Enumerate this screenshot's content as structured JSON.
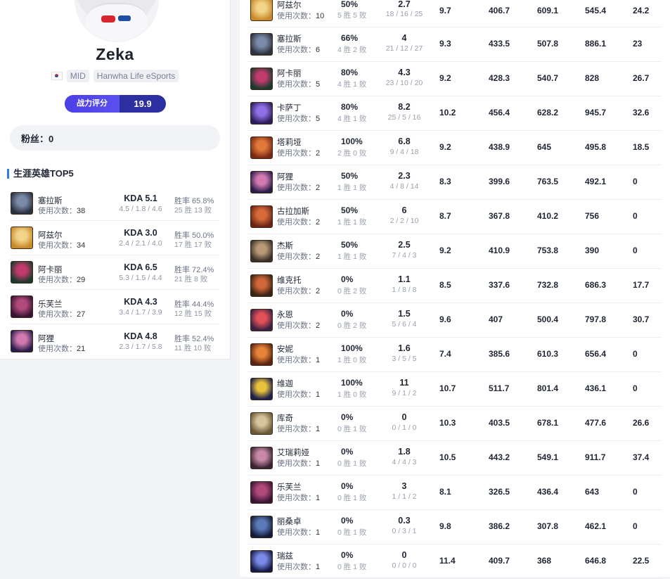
{
  "player": {
    "name": "Zeka",
    "position": "MID",
    "team": "Hanwha Life eSports",
    "rating_label": "战力评分",
    "rating_value": "19.9",
    "fans_text": "粉丝：0"
  },
  "colors": {
    "accent_blue": "#2d7be5",
    "rating_bg": "#2c2f9f",
    "rating_label_bg": "#5045ea"
  },
  "top5": {
    "title": "生涯英雄TOP5",
    "uses_label": "使用次数：",
    "items": [
      {
        "name": "塞拉斯",
        "uses": "38",
        "kda": "KDA 5.1",
        "kda_detail": "4.5 / 1.8 / 4.6",
        "winrate": "胜率 65.8%",
        "wl": "25 胜 13 败",
        "icon": "sylas-icon"
      },
      {
        "name": "阿兹尔",
        "uses": "34",
        "kda": "KDA 3.0",
        "kda_detail": "2.4 / 2.1 / 4.0",
        "winrate": "胜率 50.0%",
        "wl": "17 胜 17 败",
        "icon": "azir-icon"
      },
      {
        "name": "阿卡丽",
        "uses": "29",
        "kda": "KDA 6.5",
        "kda_detail": "5.3 / 1.5 / 4.4",
        "winrate": "胜率 72.4%",
        "wl": "21 胜 8 败",
        "icon": "akali-icon"
      },
      {
        "name": "乐芙兰",
        "uses": "27",
        "kda": "KDA 4.3",
        "kda_detail": "3.4 / 1.7 / 3.9",
        "winrate": "胜率 44.4%",
        "wl": "12 胜 15 败",
        "icon": "leblanc-icon"
      },
      {
        "name": "阿狸",
        "uses": "21",
        "kda": "KDA 4.8",
        "kda_detail": "2.3 / 1.7 / 5.8",
        "winrate": "胜率 52.4%",
        "wl": "11 胜 10 败",
        "icon": "ahri-icon"
      }
    ]
  },
  "hero_table": {
    "uses_label": "使用次数：",
    "rows": [
      {
        "name": "阿兹尔",
        "uses": "10",
        "winrate": "50%",
        "wl": "5 胜 5 败",
        "kda": "2.7",
        "kda_detail": "18 / 16 / 25",
        "c1": "9.7",
        "c2": "406.7",
        "c3": "609.1",
        "c4": "545.4",
        "c5": "24.2",
        "icon": "azir-icon"
      },
      {
        "name": "塞拉斯",
        "uses": "6",
        "winrate": "66%",
        "wl": "4 胜 2 败",
        "kda": "4",
        "kda_detail": "21 / 12 / 27",
        "c1": "9.3",
        "c2": "433.5",
        "c3": "507.8",
        "c4": "886.1",
        "c5": "23",
        "icon": "sylas-icon"
      },
      {
        "name": "阿卡丽",
        "uses": "5",
        "winrate": "80%",
        "wl": "4 胜 1 败",
        "kda": "4.3",
        "kda_detail": "23 / 10 / 20",
        "c1": "9.2",
        "c2": "428.3",
        "c3": "540.7",
        "c4": "828",
        "c5": "26.7",
        "icon": "akali-icon"
      },
      {
        "name": "卡萨丁",
        "uses": "5",
        "winrate": "80%",
        "wl": "4 胜 1 败",
        "kda": "8.2",
        "kda_detail": "25 / 5 / 16",
        "c1": "10.2",
        "c2": "456.4",
        "c3": "628.2",
        "c4": "945.7",
        "c5": "32.6",
        "icon": "kassadin-icon"
      },
      {
        "name": "塔莉垭",
        "uses": "2",
        "winrate": "100%",
        "wl": "2 胜 0 败",
        "kda": "6.8",
        "kda_detail": "9 / 4 / 18",
        "c1": "9.2",
        "c2": "438.9",
        "c3": "645",
        "c4": "495.8",
        "c5": "18.5",
        "icon": "taliyah-icon"
      },
      {
        "name": "阿狸",
        "uses": "2",
        "winrate": "50%",
        "wl": "1 胜 1 败",
        "kda": "2.3",
        "kda_detail": "4 / 8 / 14",
        "c1": "8.3",
        "c2": "399.6",
        "c3": "763.5",
        "c4": "492.1",
        "c5": "0",
        "icon": "ahri-icon"
      },
      {
        "name": "古拉加斯",
        "uses": "2",
        "winrate": "50%",
        "wl": "1 胜 1 败",
        "kda": "6",
        "kda_detail": "2 / 2 / 10",
        "c1": "8.7",
        "c2": "367.8",
        "c3": "410.2",
        "c4": "756",
        "c5": "0",
        "icon": "gragas-icon"
      },
      {
        "name": "杰斯",
        "uses": "2",
        "winrate": "50%",
        "wl": "1 胜 1 败",
        "kda": "2.5",
        "kda_detail": "7 / 4 / 3",
        "c1": "9.2",
        "c2": "410.9",
        "c3": "753.8",
        "c4": "390",
        "c5": "0",
        "icon": "jayce-icon"
      },
      {
        "name": "维克托",
        "uses": "2",
        "winrate": "0%",
        "wl": "0 胜 2 败",
        "kda": "1.1",
        "kda_detail": "1 / 8 / 8",
        "c1": "8.5",
        "c2": "337.6",
        "c3": "732.8",
        "c4": "686.3",
        "c5": "17.7",
        "icon": "viktor-icon"
      },
      {
        "name": "永恩",
        "uses": "2",
        "winrate": "0%",
        "wl": "0 胜 2 败",
        "kda": "1.5",
        "kda_detail": "5 / 6 / 4",
        "c1": "9.6",
        "c2": "407",
        "c3": "500.4",
        "c4": "797.8",
        "c5": "30.7",
        "icon": "yone-icon"
      },
      {
        "name": "安妮",
        "uses": "1",
        "winrate": "100%",
        "wl": "1 胜 0 败",
        "kda": "1.6",
        "kda_detail": "3 / 5 / 5",
        "c1": "7.4",
        "c2": "385.6",
        "c3": "610.3",
        "c4": "656.4",
        "c5": "0",
        "icon": "annie-icon"
      },
      {
        "name": "维迦",
        "uses": "1",
        "winrate": "100%",
        "wl": "1 胜 0 败",
        "kda": "11",
        "kda_detail": "9 / 1 / 2",
        "c1": "10.7",
        "c2": "511.7",
        "c3": "801.4",
        "c4": "436.1",
        "c5": "0",
        "icon": "veigar-icon"
      },
      {
        "name": "库奇",
        "uses": "1",
        "winrate": "0%",
        "wl": "0 胜 1 败",
        "kda": "0",
        "kda_detail": "0 / 1 / 0",
        "c1": "10.3",
        "c2": "403.5",
        "c3": "678.1",
        "c4": "477.6",
        "c5": "26.6",
        "icon": "corki-icon"
      },
      {
        "name": "艾瑞莉娅",
        "uses": "1",
        "winrate": "0%",
        "wl": "0 胜 1 败",
        "kda": "1.8",
        "kda_detail": "4 / 4 / 3",
        "c1": "10.5",
        "c2": "443.2",
        "c3": "549.1",
        "c4": "911.7",
        "c5": "37.4",
        "icon": "irelia-icon"
      },
      {
        "name": "乐芙兰",
        "uses": "1",
        "winrate": "0%",
        "wl": "0 胜 1 败",
        "kda": "3",
        "kda_detail": "1 / 1 / 2",
        "c1": "8.1",
        "c2": "326.5",
        "c3": "436.4",
        "c4": "643",
        "c5": "0",
        "icon": "leblanc-icon"
      },
      {
        "name": "丽桑卓",
        "uses": "1",
        "winrate": "0%",
        "wl": "0 胜 1 败",
        "kda": "0.3",
        "kda_detail": "0 / 3 / 1",
        "c1": "9.8",
        "c2": "386.2",
        "c3": "307.8",
        "c4": "462.1",
        "c5": "0",
        "icon": "lissandra-icon"
      },
      {
        "name": "瑞兹",
        "uses": "1",
        "winrate": "0%",
        "wl": "0 胜 1 败",
        "kda": "0",
        "kda_detail": "0 / 0 / 0",
        "c1": "11.4",
        "c2": "409.7",
        "c3": "368",
        "c4": "646.8",
        "c5": "22.5",
        "icon": "ryze-icon"
      }
    ]
  },
  "icon_colors": {
    "azir-icon": [
      "#c98a2a",
      "#f2d48a"
    ],
    "sylas-icon": [
      "#2c3140",
      "#7a8aa8"
    ],
    "akali-icon": [
      "#1c3a2c",
      "#c23a6e"
    ],
    "kassadin-icon": [
      "#2b1e5a",
      "#8f6ee6"
    ],
    "taliyah-icon": [
      "#7a2a14",
      "#e0783a"
    ],
    "ahri-icon": [
      "#2b1d4a",
      "#d27ab0"
    ],
    "gragas-icon": [
      "#6a2414",
      "#d66a3a"
    ],
    "jayce-icon": [
      "#3a3028",
      "#b89a78"
    ],
    "viktor-icon": [
      "#3a2414",
      "#d0663a"
    ],
    "yone-icon": [
      "#3a2040",
      "#e2505a"
    ],
    "annie-icon": [
      "#5a2410",
      "#e6843a"
    ],
    "veigar-icon": [
      "#1c1f4a",
      "#e8c23a"
    ],
    "corki-icon": [
      "#6a5838",
      "#d8c49a"
    ],
    "irelia-icon": [
      "#3a2434",
      "#c88aa8"
    ],
    "leblanc-icon": [
      "#3a1434",
      "#b04a7a"
    ],
    "lissandra-icon": [
      "#141c3a",
      "#5a7ab8"
    ],
    "ryze-icon": [
      "#141a4a",
      "#7a8ae6"
    ]
  }
}
